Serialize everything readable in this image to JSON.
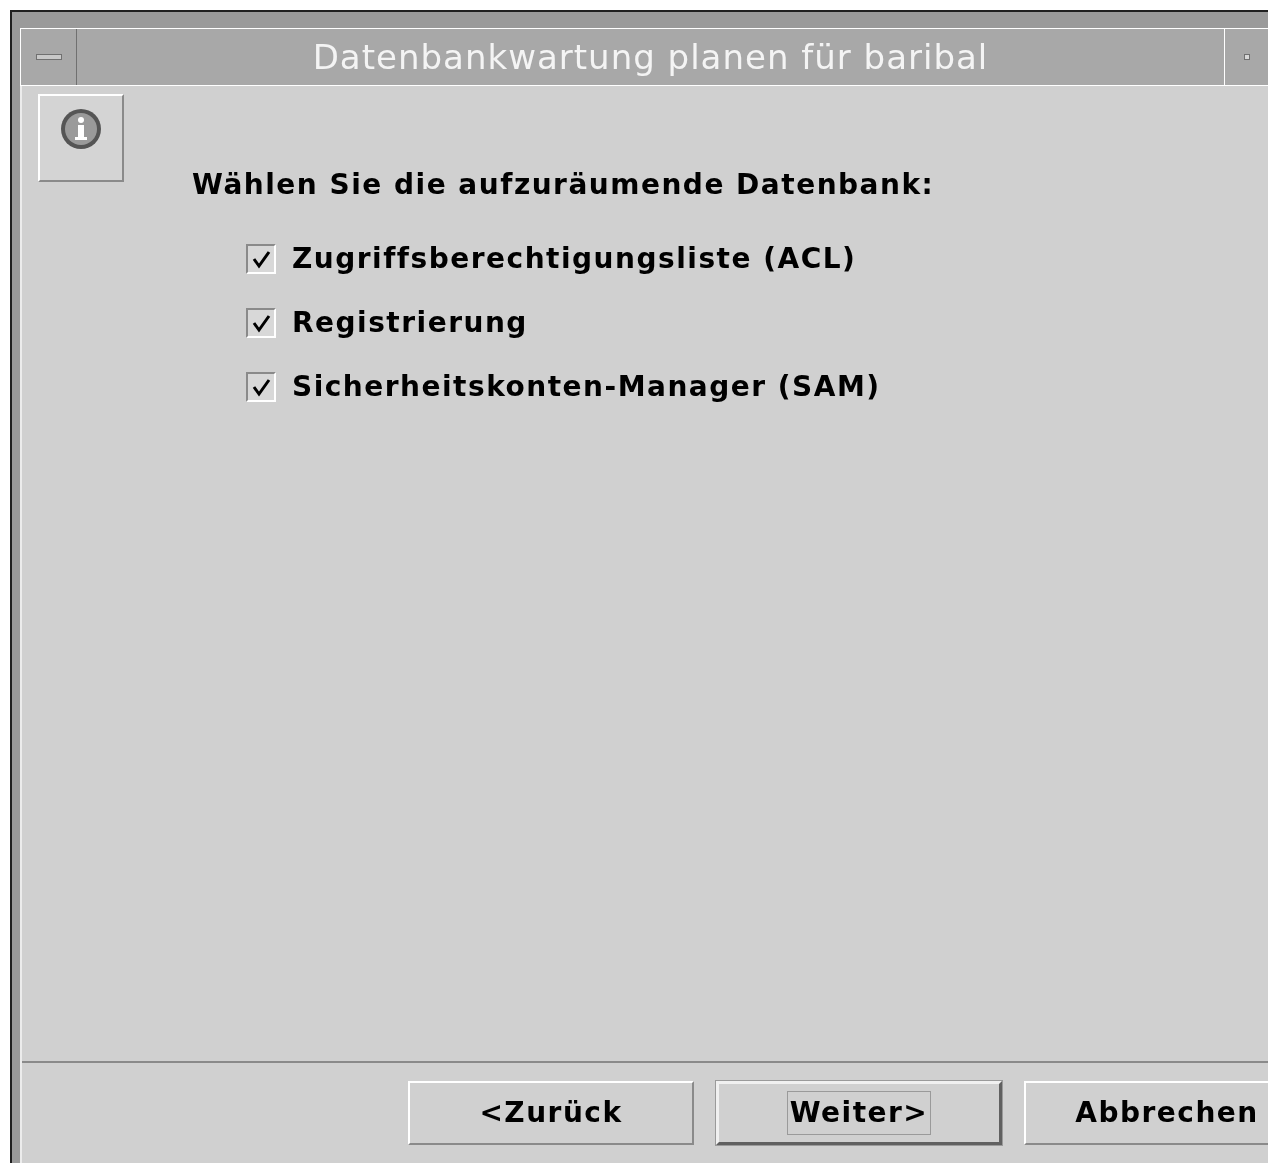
{
  "window": {
    "title": "Datenbankwartung planen für baribal"
  },
  "prompt": "Wählen Sie die aufzuräumende Datenbank:",
  "options": [
    {
      "label": "Zugriffsberechtigungsliste (ACL)",
      "checked": true
    },
    {
      "label": "Registrierung",
      "checked": true
    },
    {
      "label": "Sicherheitskonten-Manager (SAM)",
      "checked": true
    }
  ],
  "buttons": [
    {
      "label": "<Zurück",
      "default": false
    },
    {
      "label": "Weiter>",
      "default": true
    },
    {
      "label": "Abbrechen",
      "default": false
    }
  ]
}
